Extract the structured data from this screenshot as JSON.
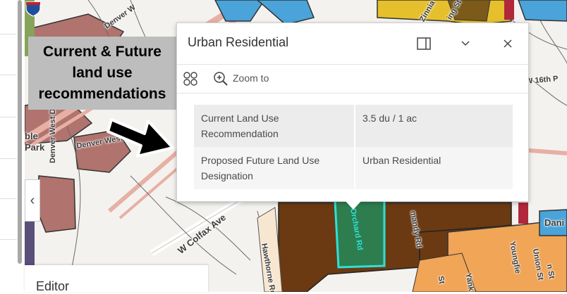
{
  "annotation": {
    "lines": [
      "Current & Future",
      "land use",
      "recommendations"
    ]
  },
  "popup": {
    "title": "Urban Residential",
    "toolbar": {
      "zoom_label": "Zoom to"
    },
    "attributes": [
      {
        "label": "Current Land Use Recommendation",
        "value": "3.5 du / 1 ac"
      },
      {
        "label": "Proposed Future Land Use Designation",
        "value": "Urban Residential"
      }
    ]
  },
  "editor": {
    "title": "Editor"
  },
  "map": {
    "road_labels": {
      "denver_west_top": "Denver W",
      "denver_west_dr": "Denver West Dr",
      "denver_west_dr_2": "Denver West Dr",
      "w_colfax_ave": "W Colfax Ave",
      "hawthorne_rd": "Hawthorne Rd",
      "orchard_rd": "Orchard Rd",
      "normandy_rd": "mandy Rd",
      "zinnia": "Zinnia",
      "w_16th": "W 16th P",
      "yankee": "Yank",
      "youngfield": "Youngfie",
      "union_st": "Union St",
      "van_gordon_st": "n St",
      "ble_park_1": "ble",
      "ble_park_2": "Park",
      "dani": "Dani",
      "st_s": "St",
      "ing_st": "ing St"
    },
    "interstate": "70",
    "colors": {
      "urban_residential": "#6b3a12",
      "commercial": "#f0a557",
      "office": "#4aa3d9",
      "parks": "#e6c02c",
      "mixed_use": "#b0736d",
      "highlight": "#2ee0d8",
      "selected_parcel": "#2e7d4f"
    }
  }
}
